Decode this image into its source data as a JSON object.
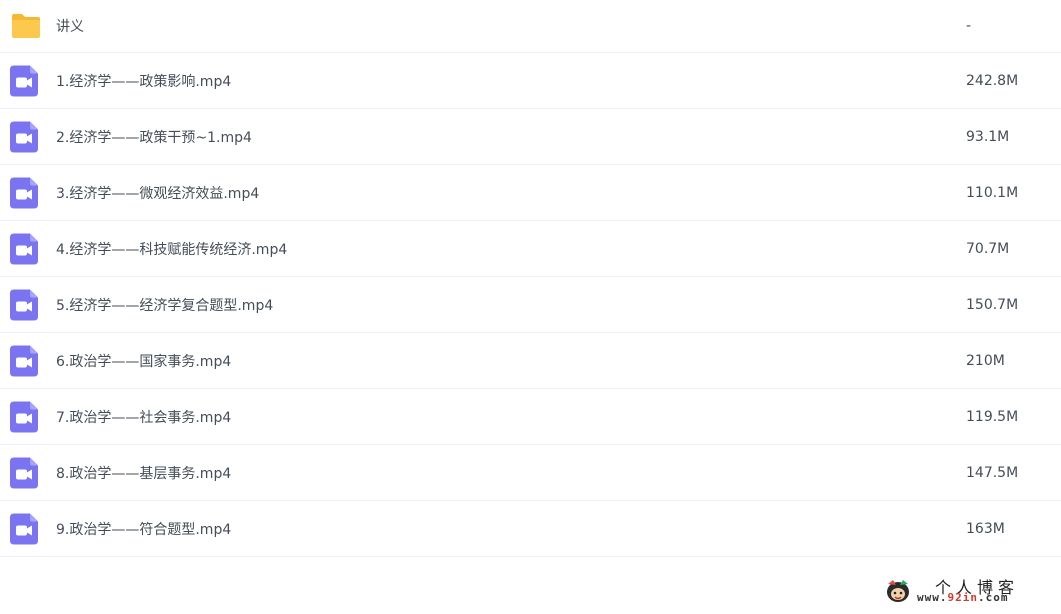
{
  "files": [
    {
      "type": "folder",
      "icon": "folder-icon",
      "name": "讲义",
      "size": "-"
    },
    {
      "type": "video",
      "icon": "video-file-icon",
      "name": "1.经济学——政策影响.mp4",
      "size": "242.8M"
    },
    {
      "type": "video",
      "icon": "video-file-icon",
      "name": "2.经济学——政策干预~1.mp4",
      "size": "93.1M"
    },
    {
      "type": "video",
      "icon": "video-file-icon",
      "name": "3.经济学——微观经济效益.mp4",
      "size": "110.1M"
    },
    {
      "type": "video",
      "icon": "video-file-icon",
      "name": "4.经济学——科技赋能传统经济.mp4",
      "size": "70.7M"
    },
    {
      "type": "video",
      "icon": "video-file-icon",
      "name": "5.经济学——经济学复合题型.mp4",
      "size": "150.7M"
    },
    {
      "type": "video",
      "icon": "video-file-icon",
      "name": "6.政治学——国家事务.mp4",
      "size": "210M"
    },
    {
      "type": "video",
      "icon": "video-file-icon",
      "name": "7.政治学——社会事务.mp4",
      "size": "119.5M"
    },
    {
      "type": "video",
      "icon": "video-file-icon",
      "name": "8.政治学——基层事务.mp4",
      "size": "147.5M"
    },
    {
      "type": "video",
      "icon": "video-file-icon",
      "name": "9.政治学——符合题型.mp4",
      "size": "163M"
    }
  ],
  "watermark": {
    "title": "个人博客",
    "url_prefix": "www.",
    "url_accent": "92in",
    "url_suffix": ".com"
  },
  "colors": {
    "folder": "#fcc94f",
    "folder_tab": "#f7b731",
    "video": "#7b74f0",
    "text": "#454d5a",
    "divider": "#eef0f4"
  }
}
